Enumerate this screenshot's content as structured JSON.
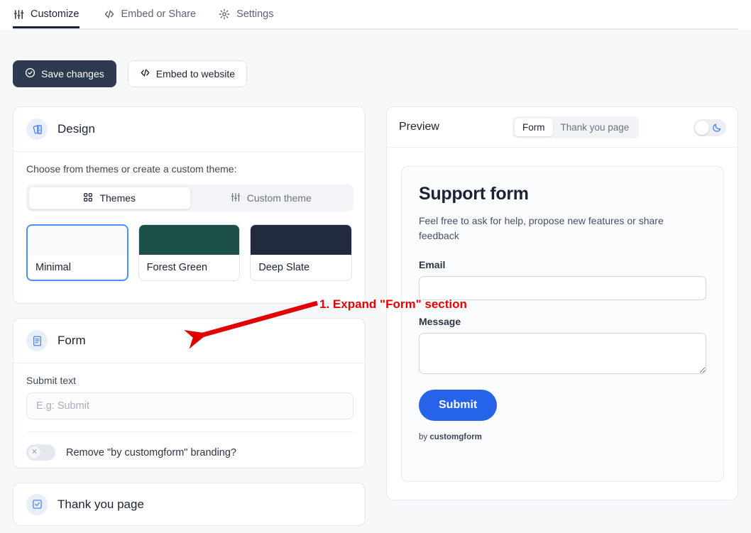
{
  "tabs": [
    {
      "label": "Customize",
      "icon": "sliders-icon",
      "active": true
    },
    {
      "label": "Embed or Share",
      "icon": "code-icon",
      "active": false
    },
    {
      "label": "Settings",
      "icon": "gear-icon",
      "active": false
    }
  ],
  "toolbar": {
    "save_label": "Save changes",
    "embed_label": "Embed to website"
  },
  "design": {
    "title": "Design",
    "helper": "Choose from themes or create a custom theme:",
    "segmented": [
      {
        "label": "Themes",
        "icon": "grid-icon",
        "active": true
      },
      {
        "label": "Custom theme",
        "icon": "sliders-icon",
        "active": false
      }
    ],
    "themes": [
      {
        "label": "Minimal",
        "color": "#f8fafc",
        "selected": true
      },
      {
        "label": "Forest Green",
        "color": "#1d5048",
        "selected": false
      },
      {
        "label": "Deep Slate",
        "color": "#222b3d",
        "selected": false
      }
    ]
  },
  "form_section": {
    "title": "Form",
    "submit_text_label": "Submit text",
    "submit_text_value": "",
    "submit_text_placeholder": "E.g: Submit",
    "branding_toggle_label": "Remove \"by customgform\" branding?",
    "branding_toggle_state": "off"
  },
  "thank_you_section": {
    "title": "Thank you page"
  },
  "preview": {
    "title": "Preview",
    "tabs": [
      {
        "label": "Form",
        "active": true
      },
      {
        "label": "Thank you page",
        "active": false
      }
    ],
    "dark_mode_toggle": "off",
    "form": {
      "heading": "Support form",
      "description": "Feel free to ask for help, propose new features or share feedback",
      "email_label": "Email",
      "email_value": "",
      "message_label": "Message",
      "message_value": "",
      "submit_label": "Submit",
      "branding_prefix": "by ",
      "branding_name": "customgform"
    }
  },
  "annotation": {
    "text": "1. Expand \"Form\" section",
    "color": "#e60000"
  }
}
